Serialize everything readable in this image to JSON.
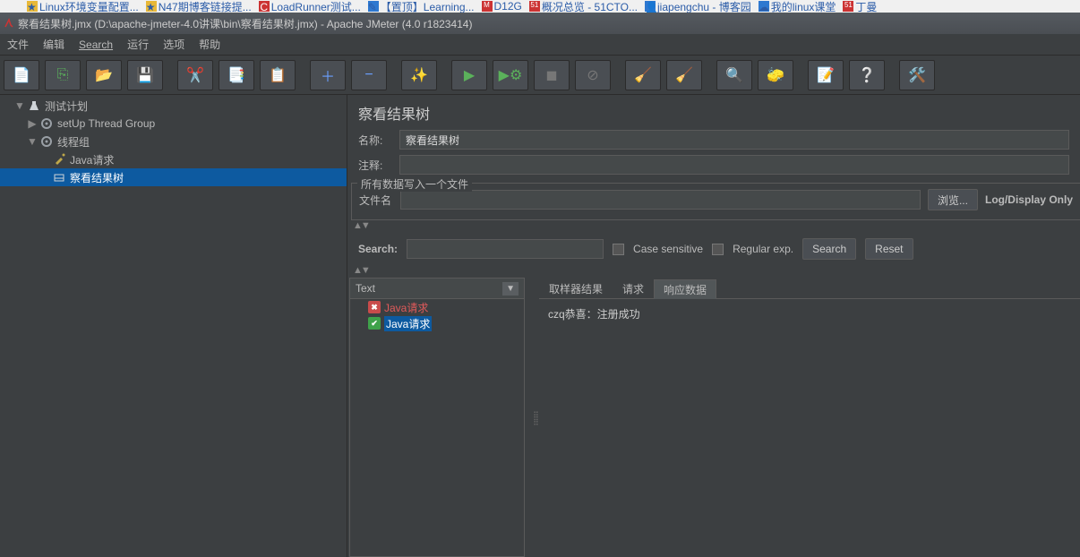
{
  "browser_tabs": [
    {
      "label": "Linux环境变量配置...",
      "color": "#e8b838"
    },
    {
      "label": "N47期博客链接提...",
      "color": "#e8b838"
    },
    {
      "label": "LoadRunner测试...",
      "color": "#c33"
    },
    {
      "label": "【置顶】Learning...",
      "color": "#2e78d0"
    },
    {
      "label": "D12G",
      "color": "#c33"
    },
    {
      "label": "概况总览 - 51CTO...",
      "color": "#c33"
    },
    {
      "label": "jiapengchu - 博客园",
      "color": "#2e78d0"
    },
    {
      "label": "我的linux课堂",
      "color": "#2e78d0"
    },
    {
      "label": "丁曼",
      "color": "#c33"
    }
  ],
  "window_title": "察看结果树.jmx (D:\\apache-jmeter-4.0讲课\\bin\\察看结果树.jmx) - Apache JMeter (4.0 r1823414)",
  "menu": [
    "文件",
    "编辑",
    "Search",
    "运行",
    "选项",
    "帮助"
  ],
  "tree": {
    "root": "测试计划",
    "setup": "setUp Thread Group",
    "group": "线程组",
    "java": "Java请求",
    "view": "察看结果树"
  },
  "panel": {
    "title": "察看结果树",
    "name_label": "名称:",
    "name_value": "察看结果树",
    "comment_label": "注释:",
    "comment_value": "",
    "write_legend": "所有数据写入一个文件",
    "file_label": "文件名",
    "file_value": "",
    "browse": "浏览...",
    "logdisplay": "Log/Display Only"
  },
  "search": {
    "label": "Search:",
    "value": "",
    "case": "Case sensitive",
    "regex": "Regular exp.",
    "search_btn": "Search",
    "reset_btn": "Reset"
  },
  "results": {
    "renderer": "Text",
    "items": [
      {
        "label": "Java请求",
        "status": "fail"
      },
      {
        "label": "Java请求",
        "status": "pass",
        "selected": true
      }
    ]
  },
  "response_tabs": {
    "sampler": "取样器结果",
    "request": "请求",
    "response": "响应数据"
  },
  "response_body": "czq恭喜：注册成功"
}
